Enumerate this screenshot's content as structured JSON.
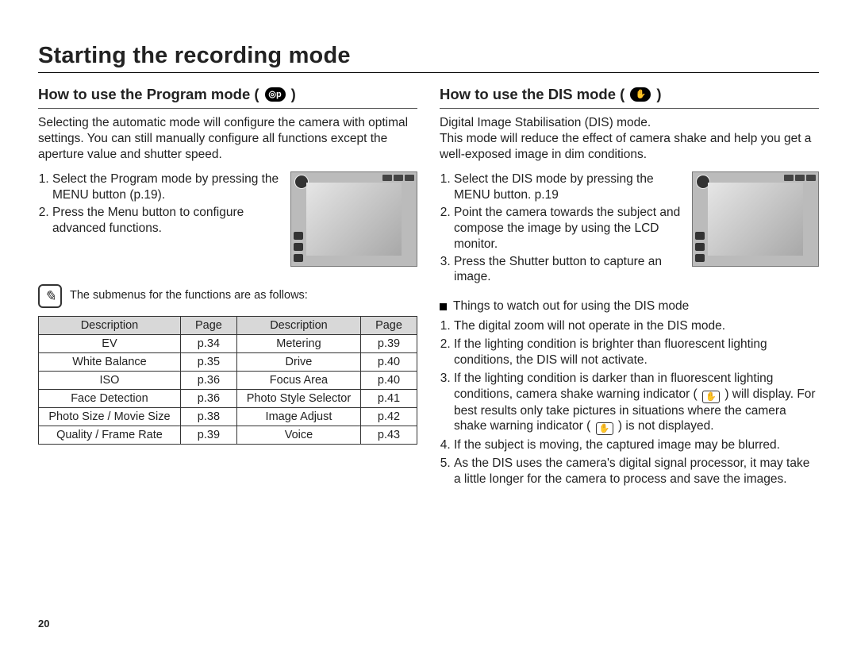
{
  "page_number": "20",
  "title": "Starting the recording mode",
  "left": {
    "heading": "How to use the Program mode (",
    "heading_close": ")",
    "mode_glyph": "◎p",
    "intro": "Selecting the automatic mode will configure the camera with optimal settings. You can still manually configure all functions except the aperture value and shutter speed.",
    "steps": [
      "Select the Program mode by pressing the MENU button (p.19).",
      "Press the Menu button to configure advanced functions."
    ],
    "note_caption": "The submenus for the functions are as follows:",
    "table": {
      "headers": [
        "Description",
        "Page",
        "Description",
        "Page"
      ],
      "rows": [
        [
          "EV",
          "p.34",
          "Metering",
          "p.39"
        ],
        [
          "White Balance",
          "p.35",
          "Drive",
          "p.40"
        ],
        [
          "ISO",
          "p.36",
          "Focus Area",
          "p.40"
        ],
        [
          "Face Detection",
          "p.36",
          "Photo Style Selector",
          "p.41"
        ],
        [
          "Photo Size / Movie Size",
          "p.38",
          "Image Adjust",
          "p.42"
        ],
        [
          "Quality / Frame Rate",
          "p.39",
          "Voice",
          "p.43"
        ]
      ]
    }
  },
  "right": {
    "heading": "How to use the DIS mode (",
    "heading_close": ")",
    "mode_glyph": "✋",
    "intro1": "Digital Image Stabilisation (DIS) mode.",
    "intro2": "This mode will reduce the effect of camera shake and help you get a well-exposed image in dim conditions.",
    "steps": [
      "Select the DIS mode by pressing the MENU button. p.19",
      "Point the camera towards the subject and compose the image by using the LCD monitor.",
      "Press the Shutter button to capture an image."
    ],
    "watch_title": "Things to watch out for using the DIS mode",
    "watch_items": [
      "The digital zoom will not operate in the DIS mode.",
      "If the lighting condition is brighter than fluorescent lighting conditions, the DIS will not activate.",
      "If the lighting condition is darker than in fluorescent lighting conditions, camera shake warning indicator ( ) will display. For best results only take pictures in situations where the camera shake warning indicator ( ) is not displayed.",
      "If the subject is moving, the captured image may be blurred.",
      "As the DIS uses the camera's digital signal processor, it may take a little longer for the camera to process and save the images."
    ],
    "hand_glyph": "✋"
  }
}
